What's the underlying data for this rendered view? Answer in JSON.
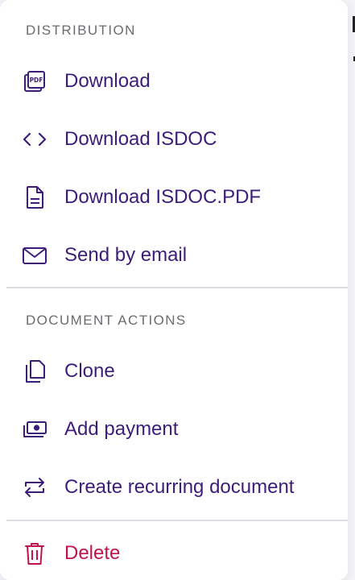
{
  "colors": {
    "accent": "#3d1d7a",
    "danger": "#c0124e",
    "section_title": "#6b6b70",
    "divider": "#dedde3"
  },
  "distribution": {
    "title": "DISTRIBUTION",
    "items": [
      {
        "label": "Download",
        "icon": "pdf-file-icon"
      },
      {
        "label": "Download ISDOC",
        "icon": "code-brackets-icon"
      },
      {
        "label": "Download ISDOC.PDF",
        "icon": "document-icon"
      },
      {
        "label": "Send by email",
        "icon": "envelope-icon"
      }
    ]
  },
  "document_actions": {
    "title": "DOCUMENT ACTIONS",
    "items": [
      {
        "label": "Clone",
        "icon": "copy-icon"
      },
      {
        "label": "Add payment",
        "icon": "banknote-icon"
      },
      {
        "label": "Create recurring document",
        "icon": "repeat-arrows-icon"
      }
    ]
  },
  "danger_actions": {
    "items": [
      {
        "label": "Delete",
        "icon": "trash-icon"
      }
    ]
  }
}
